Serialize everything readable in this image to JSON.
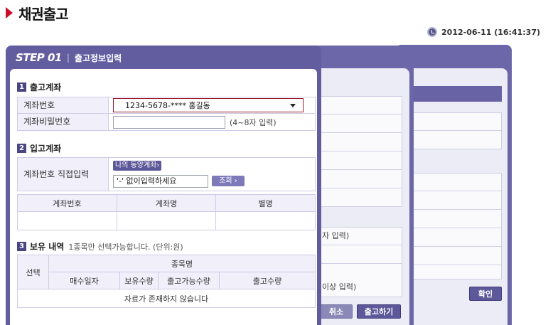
{
  "page": {
    "title": "채권출고",
    "datetime": "2012-06-11 (16:41:37)"
  },
  "step": {
    "label": "STEP 01",
    "name": "출고정보입력"
  },
  "section1": {
    "num": "1",
    "title": "출고계좌",
    "account_label": "계좌번호",
    "account_value": "1234-5678-****   홍길동",
    "password_label": "계좌비밀번호",
    "password_value": "",
    "password_hint": "(4~8자 입력)"
  },
  "section2": {
    "num": "2",
    "title": "입고계좌",
    "direct_label": "계좌번호 직접입력",
    "my_account_button": "나의 동양계좌›",
    "account_input": "'-' 없이입력하세요",
    "lookup_button": "조회 ›",
    "table_headers": [
      "계좌번호",
      "계좌명",
      "별명"
    ]
  },
  "section3": {
    "num": "3",
    "title": "보유 내역",
    "note": "1종목만 선택가능합니다. (단위:원)",
    "select_header": "선택",
    "item_header": "종목명",
    "sub_headers": [
      "매수일자",
      "보유수량",
      "출고가능수량",
      "출고수량"
    ],
    "empty_message": "자료가 존재하지 않습니다"
  },
  "step2_partial": {
    "hint1": "자 입력)",
    "hint2": "이상 입력)",
    "cancel_button": "취소",
    "submit_button": "출고하기"
  },
  "step3_partial": {
    "confirm_button": "확인"
  }
}
